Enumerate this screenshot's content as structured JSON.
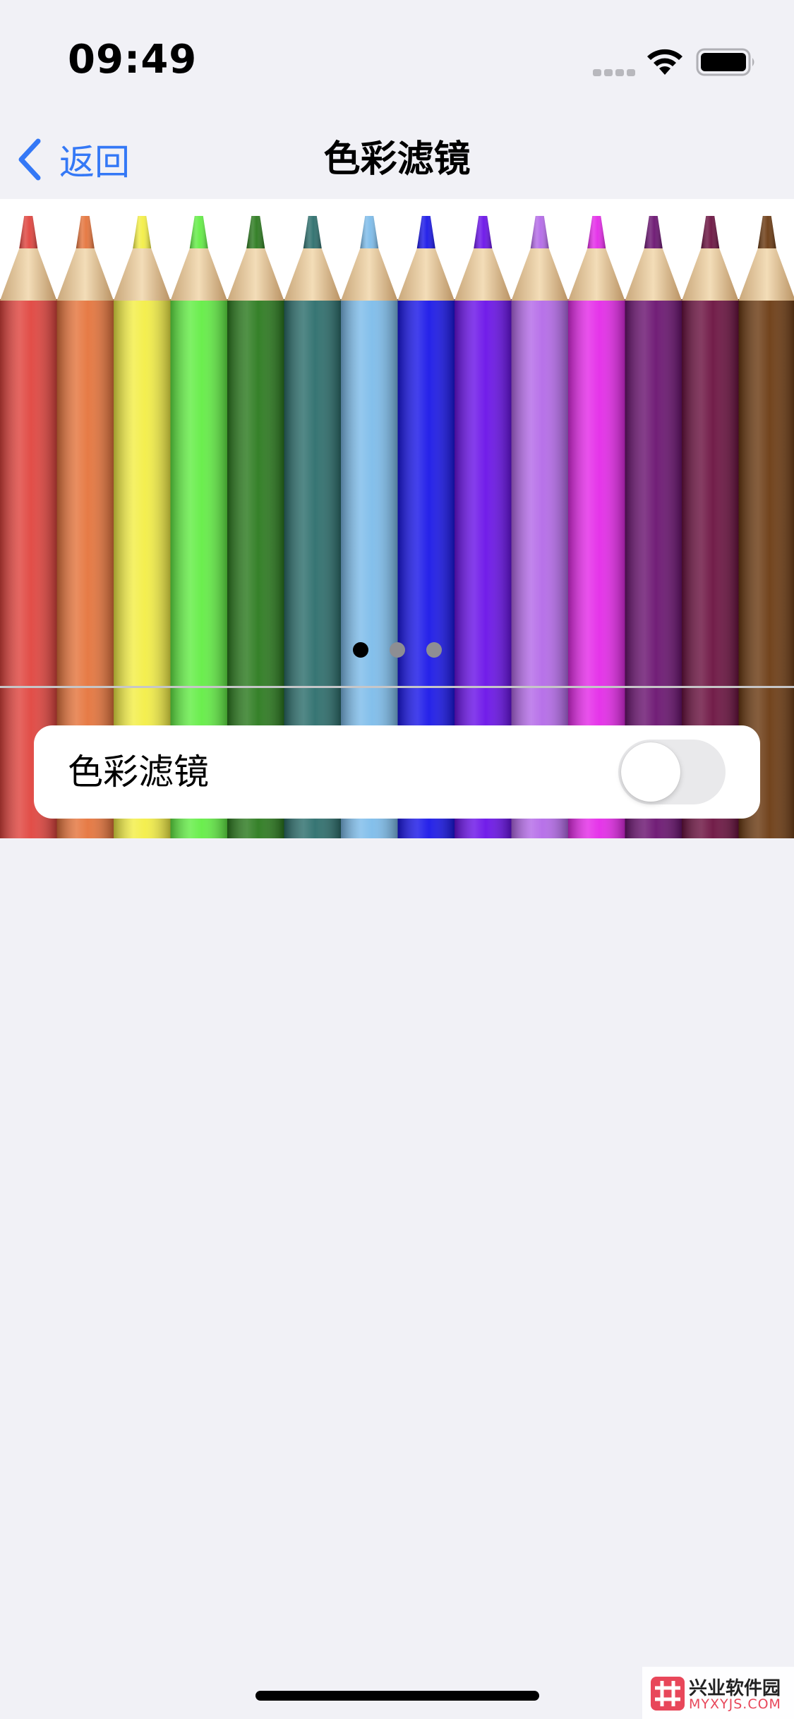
{
  "status_bar": {
    "time": "09:49",
    "icons": [
      "cellular-signal-icon",
      "wifi-icon",
      "battery-icon"
    ]
  },
  "nav": {
    "back_label": "返回",
    "title": "色彩滤镜"
  },
  "preview": {
    "pencil_colors": [
      "#e0443e",
      "#e5743c",
      "#f3ee46",
      "#63ed45",
      "#2b7a1e",
      "#2c6e6c",
      "#7dbcea",
      "#1a17e8",
      "#6a12e8",
      "#b46ae8",
      "#e42ae8",
      "#6a1370",
      "#6b1240",
      "#6b3a12"
    ],
    "page_count": 3,
    "current_page": 1
  },
  "settings": {
    "color_filters_label": "色彩滤镜",
    "color_filters_enabled": false
  },
  "watermark": {
    "text": "兴业软件园",
    "subtext": "MYXYJS.COM"
  }
}
